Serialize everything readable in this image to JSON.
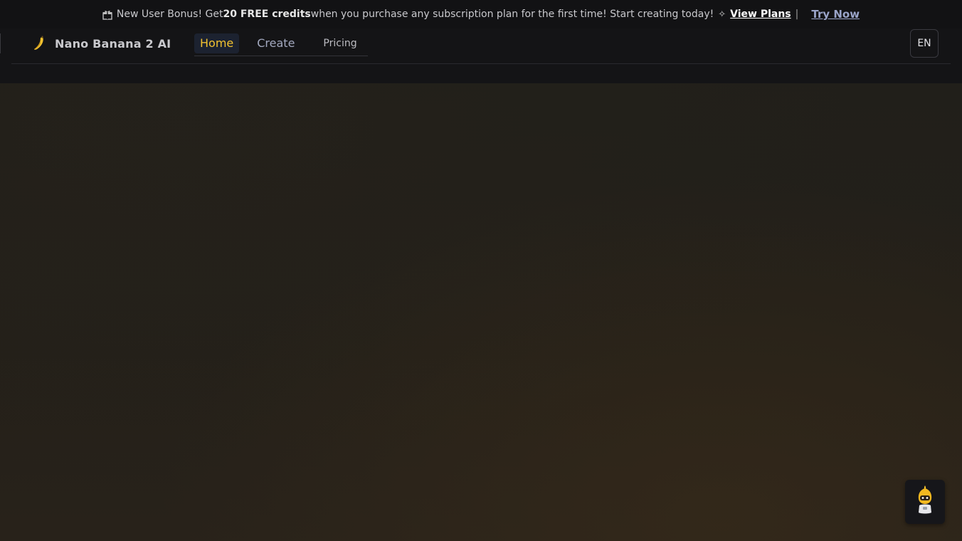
{
  "announcement": {
    "gift_icon": "gift-icon",
    "text_before": "New User Bonus! Get ",
    "highlight": "20 FREE credits",
    "text_after": " when you purchase any subscription plan for the first time! Start creating today!",
    "sparkle_icon": "sparkle-icon",
    "view_plans_label": "View Plans",
    "separator": "|",
    "try_now_label": "Try Now"
  },
  "header": {
    "brand_icon": "banana-icon",
    "brand_name": "Nano Banana 2 AI",
    "nav": {
      "home": "Home",
      "create": "Create",
      "pricing": "Pricing"
    },
    "language_label": "EN"
  },
  "assistant": {
    "icon": "robot-assistant-icon"
  },
  "colors": {
    "accent": "#f2c230",
    "background": "#1e1b16",
    "header_background": "#141416"
  }
}
